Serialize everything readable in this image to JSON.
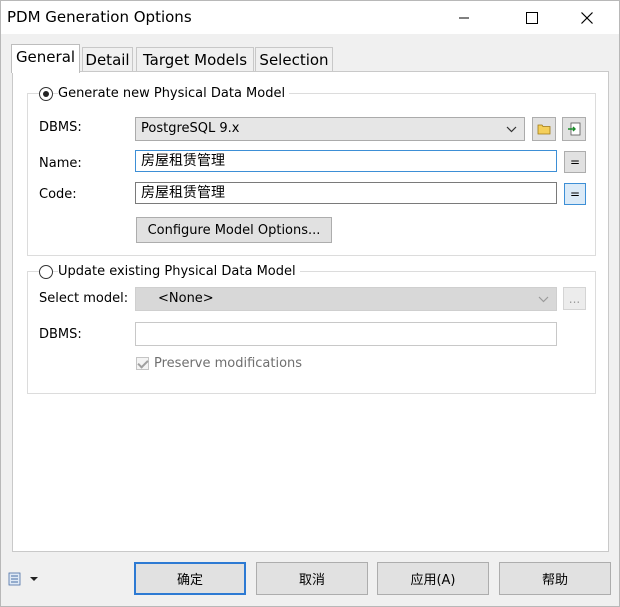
{
  "window": {
    "title": "PDM Generation Options"
  },
  "tabs": [
    {
      "label": "General",
      "active": true
    },
    {
      "label": "Detail",
      "active": false
    },
    {
      "label": "Target Models",
      "active": false
    },
    {
      "label": "Selection",
      "active": false
    }
  ],
  "generate_new": {
    "label": "Generate new Physical Data Model",
    "selected": true,
    "dbms_label": "DBMS:",
    "dbms_value": "PostgreSQL 9.x",
    "name_label": "Name:",
    "name_value": "房屋租赁管理",
    "code_label": "Code:",
    "code_value": "房屋租赁管理",
    "equals_glyph": "=",
    "configure_button": "Configure Model Options..."
  },
  "update_existing": {
    "label": "Update existing Physical Data Model",
    "selected": false,
    "select_model_label": "Select model:",
    "select_model_value": "<None>",
    "browse_glyph": "...",
    "dbms_label": "DBMS:",
    "dbms_value": "",
    "preserve_label": "Preserve modifications",
    "preserve_checked": true
  },
  "footer": {
    "ok": "确定",
    "cancel": "取消",
    "apply": "应用(A)",
    "help": "帮助"
  },
  "colors": {
    "accent": "#2d7ad3",
    "focus_border": "#3d8fd6"
  },
  "icons": [
    "minimize-icon",
    "maximize-icon",
    "close-icon",
    "chevron-down-icon",
    "folder-icon",
    "import-icon",
    "document-list-icon"
  ]
}
